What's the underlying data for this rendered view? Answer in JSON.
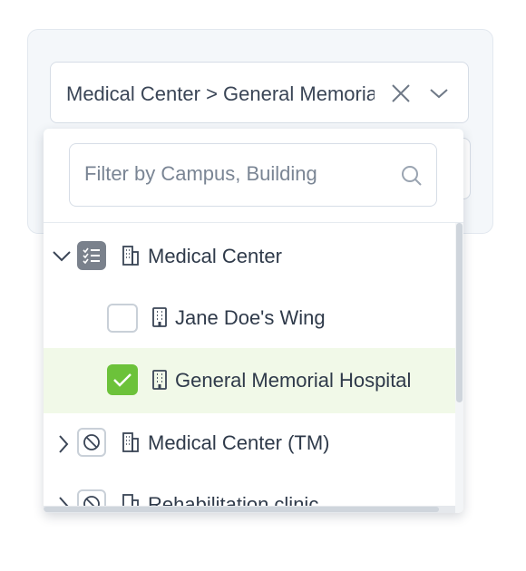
{
  "select": {
    "value": "Medical Center > General Memorial Hospital"
  },
  "search": {
    "placeholder": "Filter by Campus, Building"
  },
  "tree": [
    {
      "label": "Medical Center",
      "expander": "chevron-down-icon",
      "state": "indeterminate",
      "icon": "building-icon"
    },
    {
      "label": "Jane Doe's Wing",
      "state": "unchecked",
      "icon": "building-icon"
    },
    {
      "label": "General Memorial Hospital",
      "state": "checked",
      "icon": "building-icon"
    },
    {
      "label": "Medical Center (TM)",
      "expander": "chevron-right-icon",
      "state": "disabled",
      "icon": "building-icon"
    },
    {
      "label": "Rehabilitation clinic",
      "expander": "chevron-right-icon",
      "state": "disabled",
      "icon": "building-icon"
    }
  ],
  "colors": {
    "checked": "#6cc23a",
    "selected_row": "#f1f9e8",
    "indeterminate": "#7a818c"
  }
}
